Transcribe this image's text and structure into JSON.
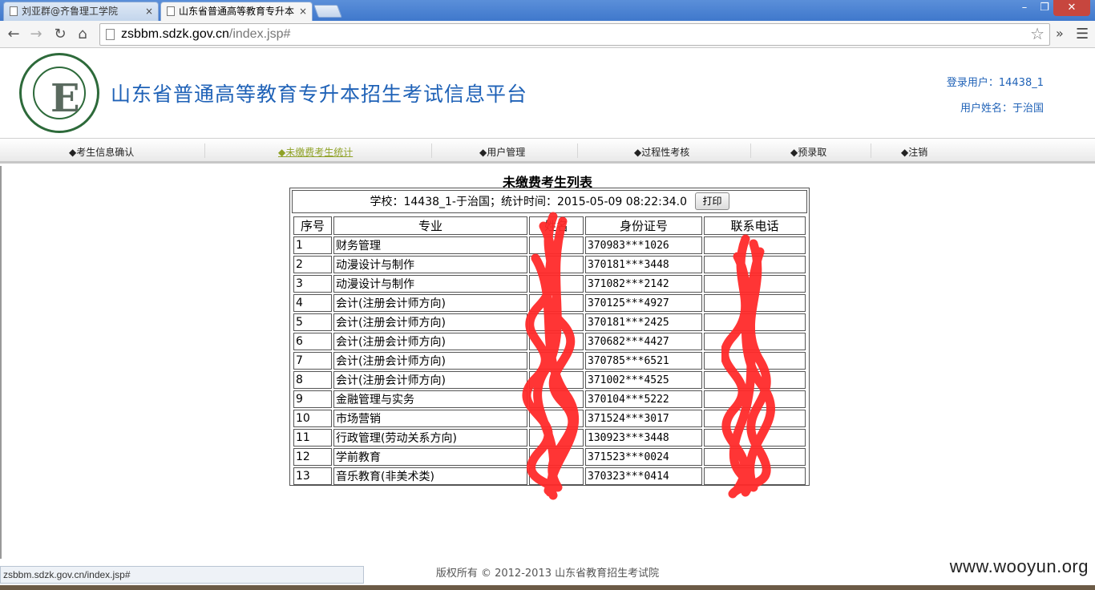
{
  "browser": {
    "tabs": [
      {
        "title": "刘亚群@齐鲁理工学院",
        "active": false
      },
      {
        "title": "山东省普通高等教育专升本",
        "active": true
      }
    ],
    "close_glyph": "×",
    "url_host": "zsbbm.sdzk.gov.cn",
    "url_path": "/index.jsp#",
    "status_url": "zsbbm.sdzk.gov.cn/index.jsp#"
  },
  "header": {
    "site_title": "山东省普通高等教育专升本招生考试信息平台",
    "login_user": "登录用户：14438_1",
    "user_name": "用户姓名：于治国"
  },
  "menu": [
    {
      "label": "◆考生信息确认",
      "active": false
    },
    {
      "label": "◆未缴费考生统计",
      "active": true
    },
    {
      "label": "◆用户管理",
      "active": false
    },
    {
      "label": "◆过程性考核",
      "active": false
    },
    {
      "label": "◆预录取",
      "active": false
    },
    {
      "label": "◆注销",
      "active": false
    }
  ],
  "list": {
    "title": "未缴费考生列表",
    "info": "学校：14438_1-于治国；统计时间：2015-05-09 08:22:34.0",
    "print_label": "打印",
    "columns": [
      "序号",
      "专业",
      "姓名",
      "身份证号",
      "联系电话"
    ],
    "rows": [
      {
        "no": "1",
        "major": "财务管理",
        "name": "",
        "id": "370983***1026",
        "phone": ""
      },
      {
        "no": "2",
        "major": "动漫设计与制作",
        "name": "",
        "id": "370181***3448",
        "phone": ""
      },
      {
        "no": "3",
        "major": "动漫设计与制作",
        "name": "",
        "id": "371082***2142",
        "phone": ""
      },
      {
        "no": "4",
        "major": "会计(注册会计师方向)",
        "name": "",
        "id": "370125***4927",
        "phone": ""
      },
      {
        "no": "5",
        "major": "会计(注册会计师方向)",
        "name": "",
        "id": "370181***2425",
        "phone": ""
      },
      {
        "no": "6",
        "major": "会计(注册会计师方向)",
        "name": "",
        "id": "370682***4427",
        "phone": ""
      },
      {
        "no": "7",
        "major": "会计(注册会计师方向)",
        "name": "",
        "id": "370785***6521",
        "phone": ""
      },
      {
        "no": "8",
        "major": "会计(注册会计师方向)",
        "name": "",
        "id": "371002***4525",
        "phone": ""
      },
      {
        "no": "9",
        "major": "金融管理与实务",
        "name": "",
        "id": "370104***5222",
        "phone": ""
      },
      {
        "no": "10",
        "major": "市场营销",
        "name": "",
        "id": "371524***3017",
        "phone": ""
      },
      {
        "no": "11",
        "major": "行政管理(劳动关系方向)",
        "name": "",
        "id": "130923***3448",
        "phone": ""
      },
      {
        "no": "12",
        "major": "学前教育",
        "name": "",
        "id": "371523***0024",
        "phone": ""
      },
      {
        "no": "13",
        "major": "音乐教育(非美术类)",
        "name": "",
        "id": "370323***0414",
        "phone": ""
      }
    ]
  },
  "footer": {
    "copyright": "版权所有 © 2012-2013 山东省教育招生考试院",
    "watermark": "www.wooyun.org"
  },
  "colors": {
    "title_blue": "#1f62b7",
    "menu_active": "#8fa227",
    "redaction": "#ff2a2a"
  }
}
